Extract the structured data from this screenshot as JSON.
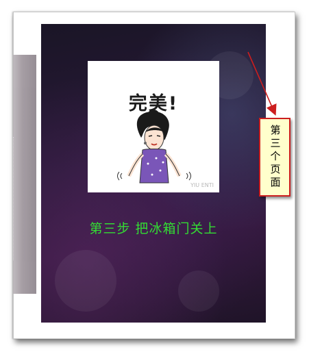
{
  "slide": {
    "sticker_title": "完美!",
    "sticker_watermark": "YIU ENTI",
    "caption": "第三步 把冰箱门关上"
  },
  "annotation": {
    "label": "第三个页面"
  },
  "colors": {
    "caption": "#33dd33",
    "annotation_border": "#cc1e1e",
    "annotation_fill": "#ffffcc",
    "dress": "#7a56b8"
  },
  "icons": {
    "sticker_character": "woman-qipao-sticker-icon",
    "annotation_arrow": "red-arrow-icon"
  }
}
